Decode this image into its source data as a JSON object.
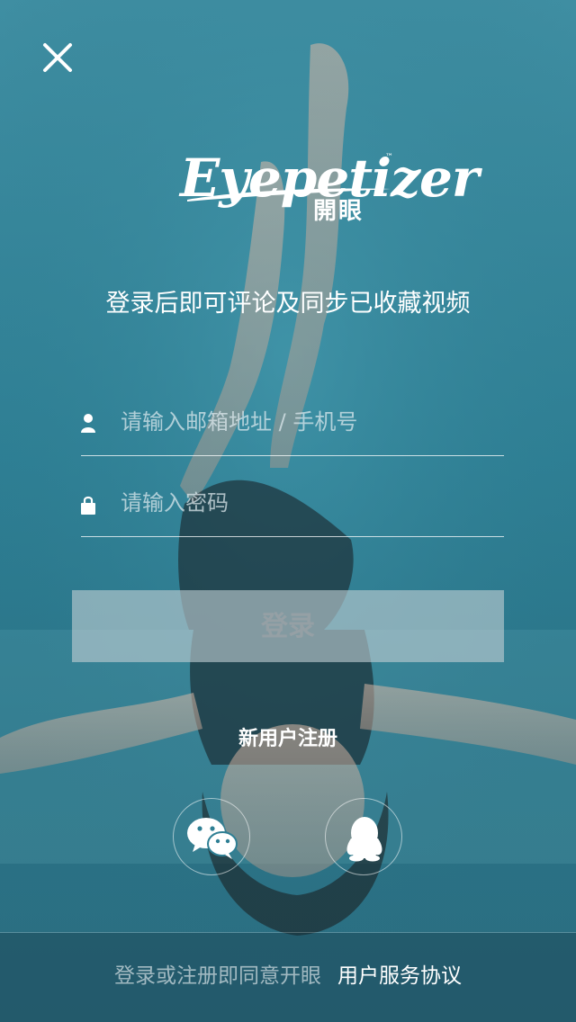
{
  "header": {
    "close_icon": "close-icon"
  },
  "logo": {
    "brand": "Eyepetizer",
    "trademark": "™",
    "chinese_name": "開眼"
  },
  "tagline": "登录后即可评论及同步已收藏视频",
  "form": {
    "email": {
      "icon": "user-icon",
      "placeholder": "请输入邮箱地址 / 手机号",
      "value": ""
    },
    "password": {
      "icon": "lock-icon",
      "placeholder": "请输入密码",
      "value": ""
    },
    "login_label": "登录"
  },
  "register_label": "新用户注册",
  "social": {
    "wechat_icon": "wechat-icon",
    "qq_icon": "qq-icon"
  },
  "footer": {
    "prefix": "登录或注册即同意开眼",
    "link": "用户服务协议"
  },
  "colors": {
    "background": "#2e7f94",
    "text": "#ffffff",
    "login_button_bg": "#bccdd2"
  }
}
